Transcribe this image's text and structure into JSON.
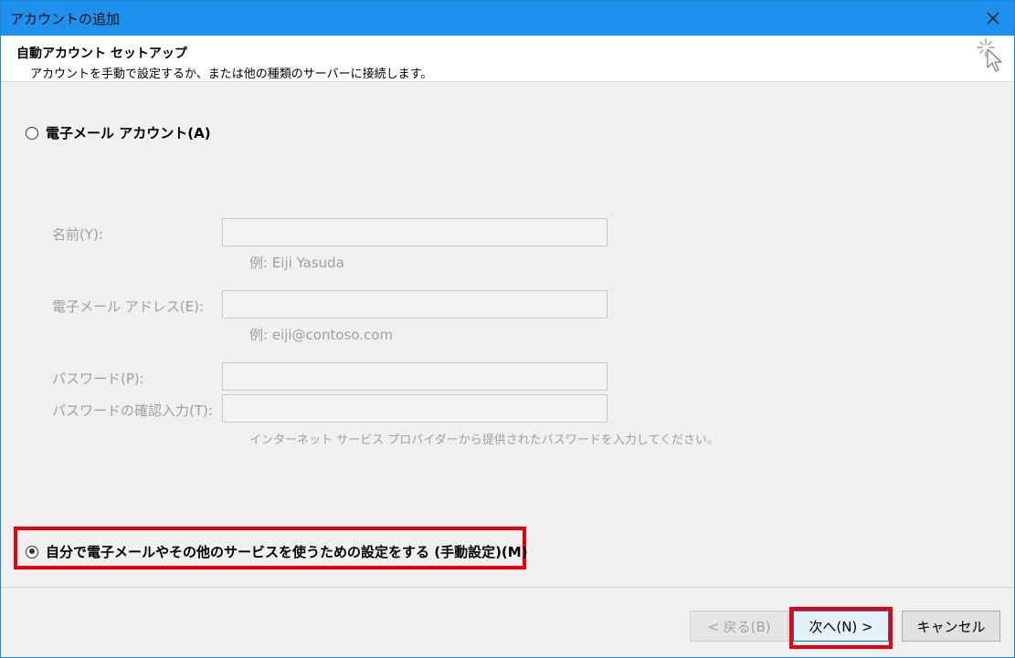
{
  "window": {
    "title": "アカウントの追加",
    "close_label": "×"
  },
  "header": {
    "title": "自動アカウント セットアップ",
    "subtitle": "アカウントを手動で設定するか、または他の種類のサーバーに接続します。"
  },
  "options": {
    "email_account": {
      "label": "電子メール アカウント(A)",
      "checked": false
    },
    "manual_setup": {
      "label": "自分で電子メールやその他のサービスを使うための設定をする (手動設定)(M)",
      "checked": true
    }
  },
  "form": {
    "name": {
      "label": "名前(Y):",
      "value": "",
      "example": "例: Eiji Yasuda"
    },
    "email": {
      "label": "電子メール アドレス(E):",
      "value": "",
      "example": "例: eiji@contoso.com"
    },
    "password": {
      "label": "パスワード(P):",
      "value": ""
    },
    "password_confirm": {
      "label": "パスワードの確認入力(T):",
      "value": ""
    },
    "password_hint": "インターネット サービス プロバイダーから提供されたパスワードを入力してください。"
  },
  "buttons": {
    "back": "< 戻る(B)",
    "next": "次へ(N) >",
    "cancel": "キャンセル"
  },
  "colors": {
    "titlebar": "#1e90ee",
    "highlight": "#e8000b"
  }
}
